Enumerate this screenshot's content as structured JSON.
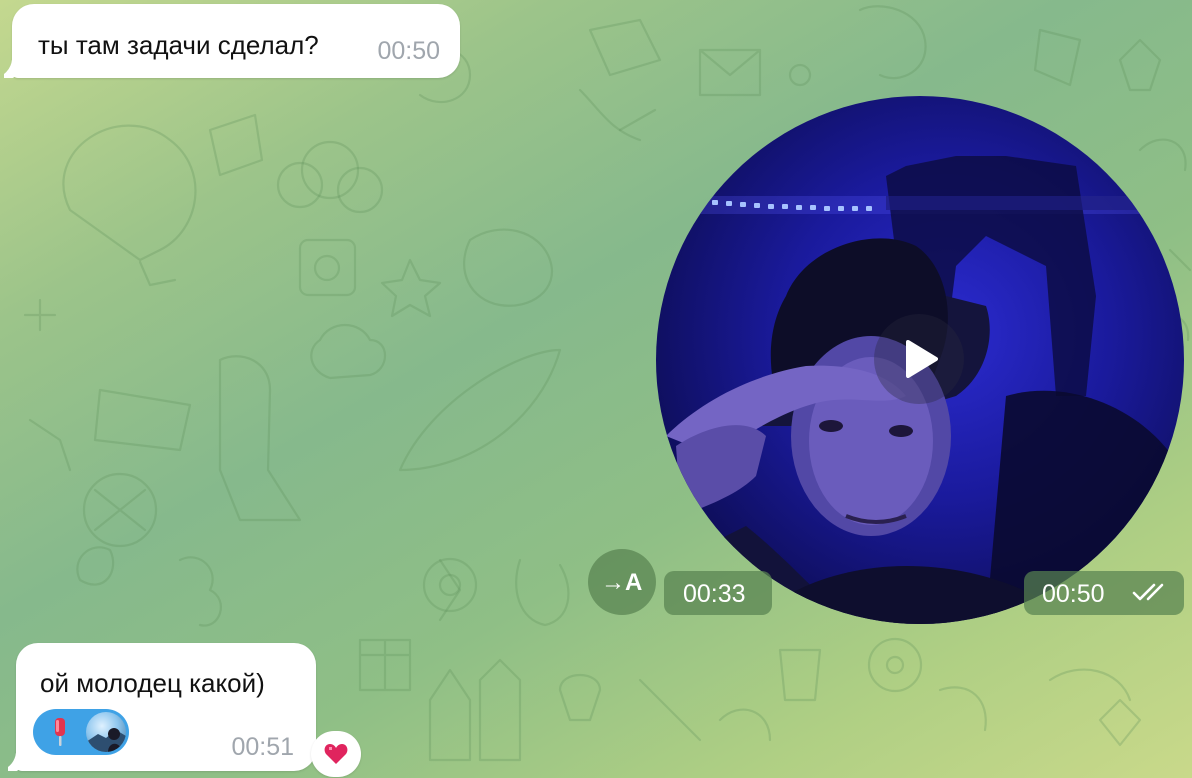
{
  "messages": [
    {
      "text": "ты там задачи сделал?",
      "time": "00:50"
    },
    {
      "text": "ой молодец какой)",
      "time": "00:51",
      "reaction": "heart"
    }
  ],
  "video_note": {
    "duration": "00:33",
    "time": "00:50",
    "status": "read-double-check",
    "transcribe_label": "→A"
  },
  "colors": {
    "bubble": "#ffffff",
    "time_gray": "#a0a6ad",
    "badge_bg": "#58824f",
    "sticker_pill": "#3fa2e6",
    "heart": "#e0245e"
  }
}
